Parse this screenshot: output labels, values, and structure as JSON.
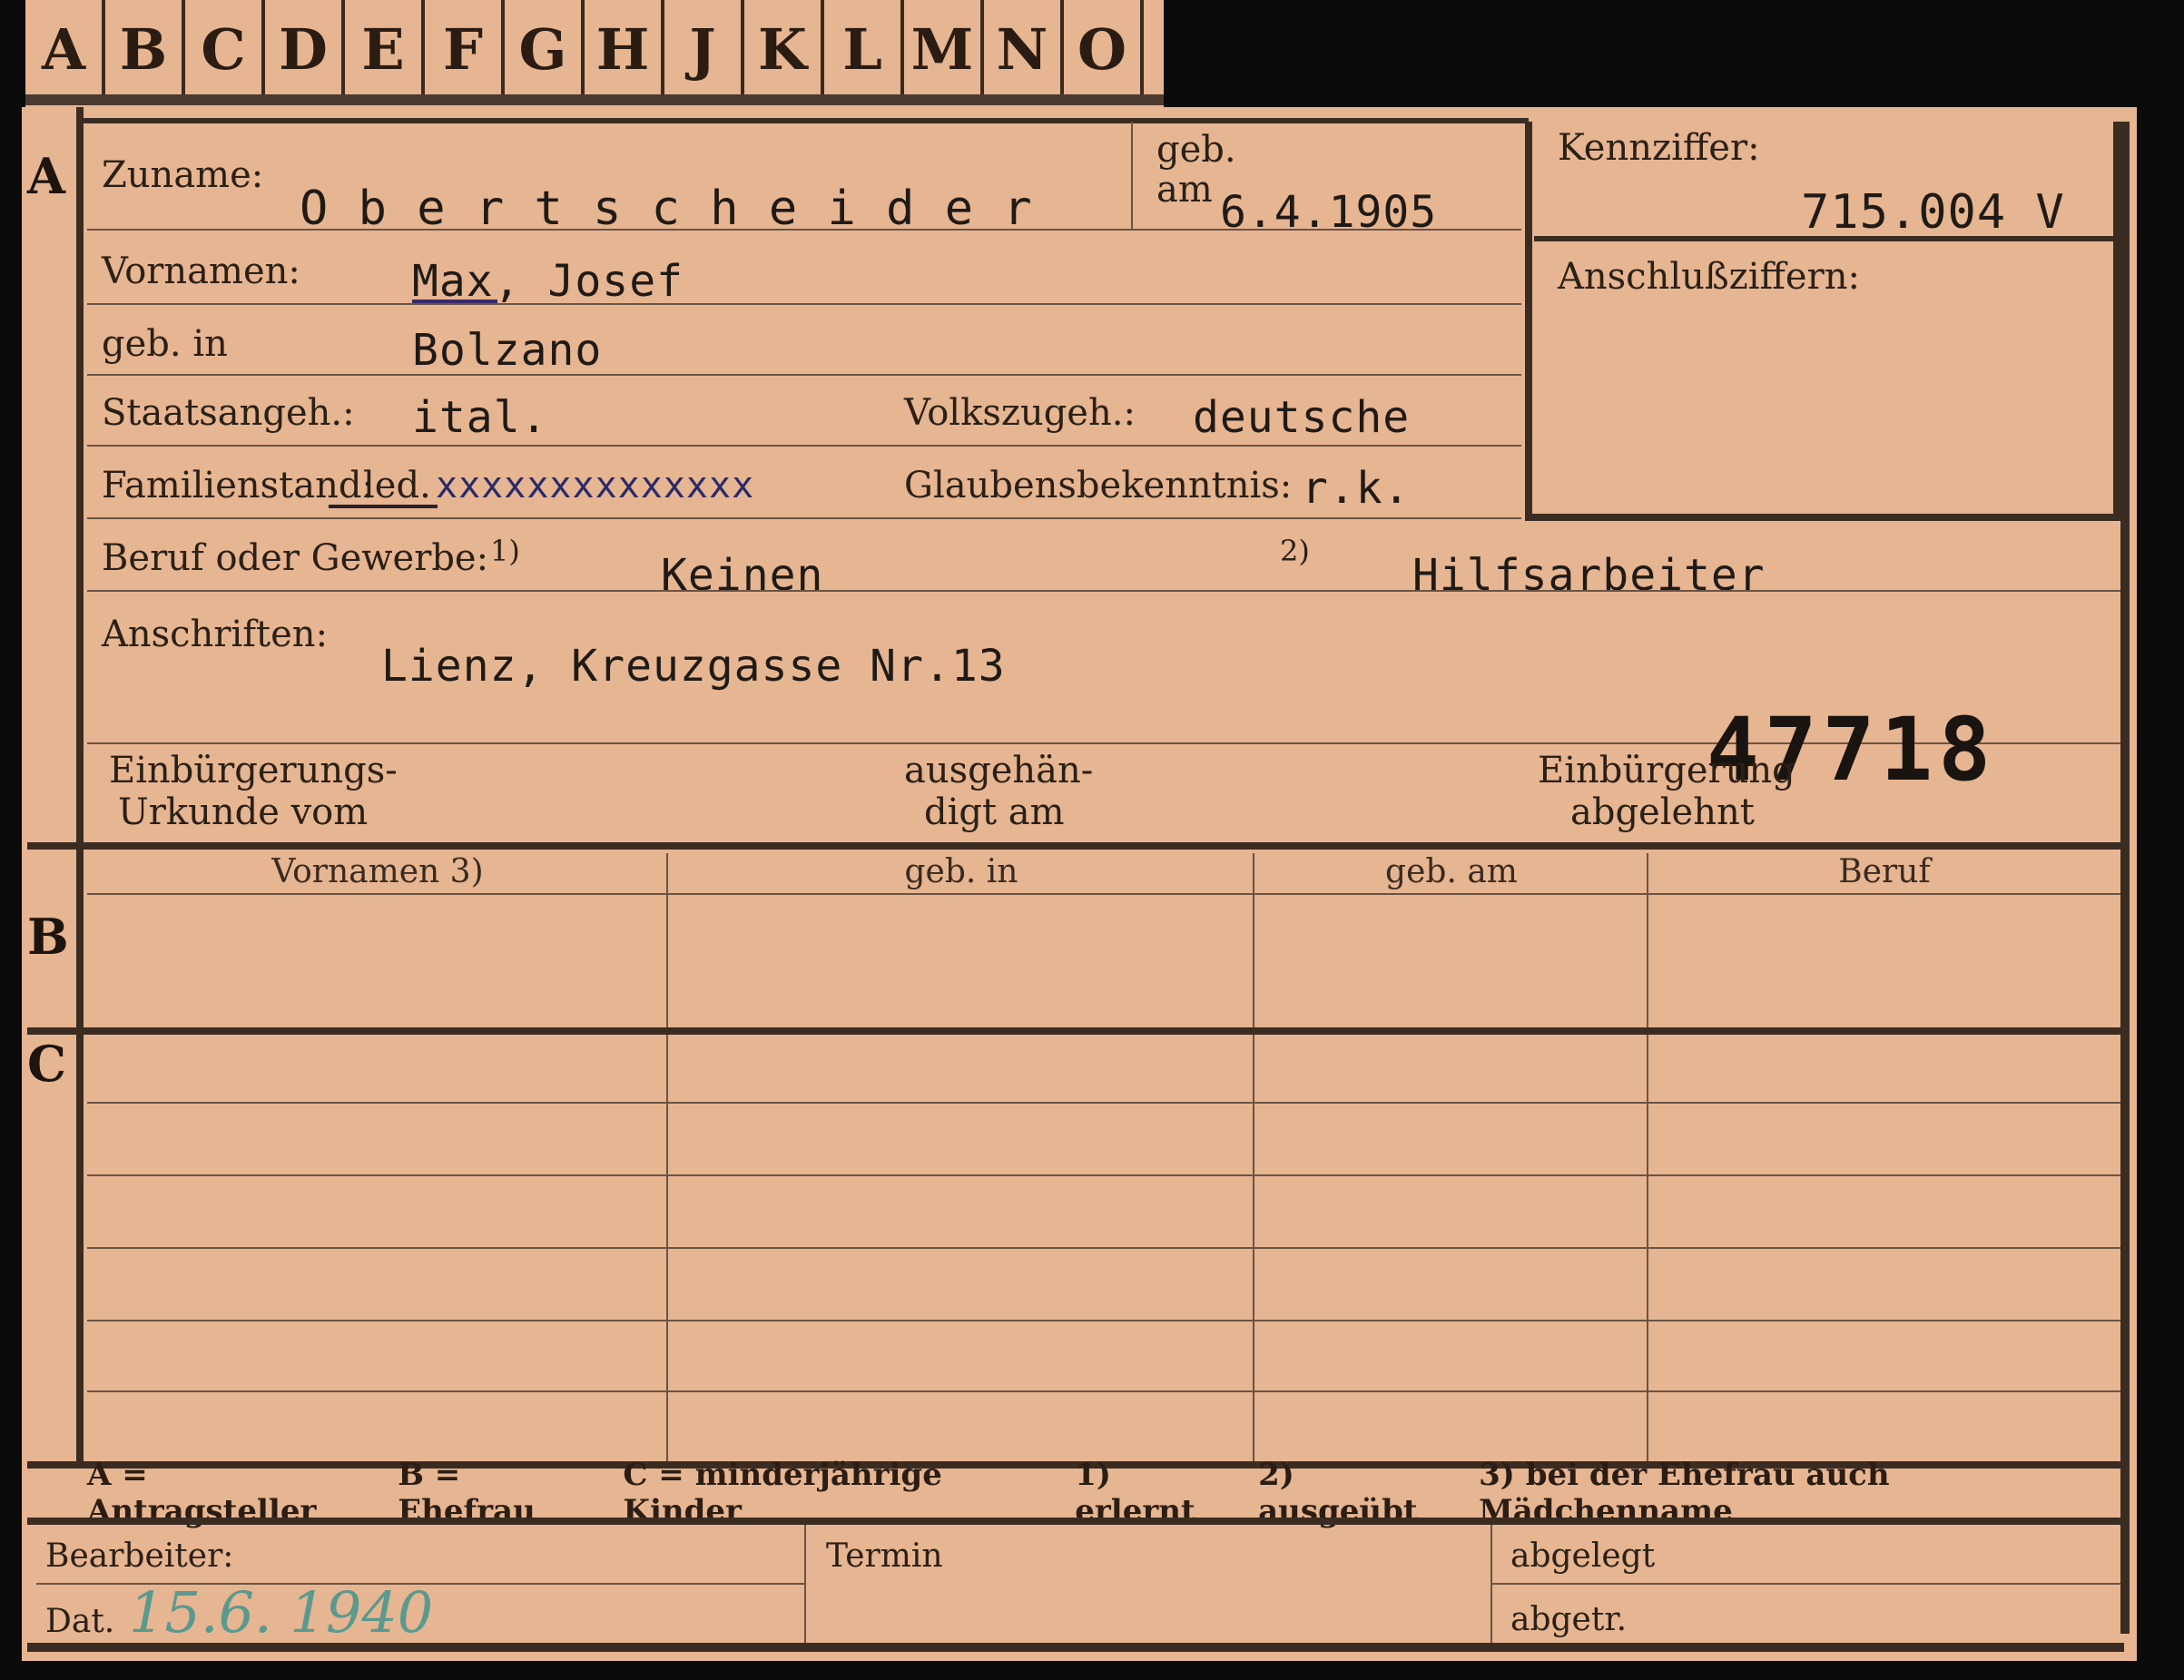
{
  "tabs": [
    "A",
    "B",
    "C",
    "D",
    "E",
    "F",
    "G",
    "H",
    "J",
    "K",
    "L",
    "M",
    "N",
    "O"
  ],
  "sections": {
    "a": "A",
    "b": "B",
    "c": "C"
  },
  "fields": {
    "zuname_label": "Zuname:",
    "zuname_value": "O b e r t s c h e i d e r",
    "geb_am_label_1": "geb.",
    "geb_am_label_2": "am",
    "geb_am_value": "6.4.1905",
    "kennziffer_label": "Kennziffer:",
    "kennziffer_value": "715.004  V",
    "anschluss_label": "Anschlußziffern:",
    "vornamen_label": "Vornamen:",
    "vornamen_value": "Max, Josef",
    "geb_in_label": "geb. in",
    "geb_in_value": "Bolzano",
    "staatsangeh_label": "Staatsangeh.:",
    "staatsangeh_value": "ital.",
    "volkszugeh_label": "Volkszugeh.:",
    "volkszugeh_value": "deutsche",
    "familienstand_label": "Familienstand:",
    "familienstand_value": "led.",
    "familienstand_struck": "xxxxxxxxxxxxxx",
    "glaube_label": "Glaubensbekenntnis:",
    "glaube_value": "r.k.",
    "beruf_label": "Beruf oder Gewerbe:",
    "beruf_mark1": "1)",
    "beruf_value1": "Keinen",
    "beruf_mark2": "2)",
    "beruf_value2": "Hilfsarbeiter",
    "anschriften_label": "Anschriften:",
    "anschriften_value": "Lienz, Kreuzgasse Nr.13",
    "number_stamp": "47718",
    "einb_urkunde_1": "Einbürgerungs-",
    "einb_urkunde_2": "Urkunde vom",
    "ausgeh_1": "ausgehän-",
    "ausgeh_2": "digt am",
    "einb_abgelehnt_1": "Einbürgerung",
    "einb_abgelehnt_2": "abgelehnt"
  },
  "table_headers": [
    "Vornamen 3)",
    "geb. in",
    "geb. am",
    "Beruf"
  ],
  "legend": [
    "A = Antragsteller",
    "B = Ehefrau",
    "C = minderjährige Kinder",
    "1) erlernt",
    "2) ausgeübt",
    "3) bei der Ehefrau auch Mädchenname"
  ],
  "footer": {
    "bearbeiter_label": "Bearbeiter:",
    "dat_label": "Dat.",
    "dat_value": "15.6. 1940",
    "termin_label": "Termin",
    "abgelegt_label": "abgelegt",
    "abgetr_label": "abgetr."
  }
}
